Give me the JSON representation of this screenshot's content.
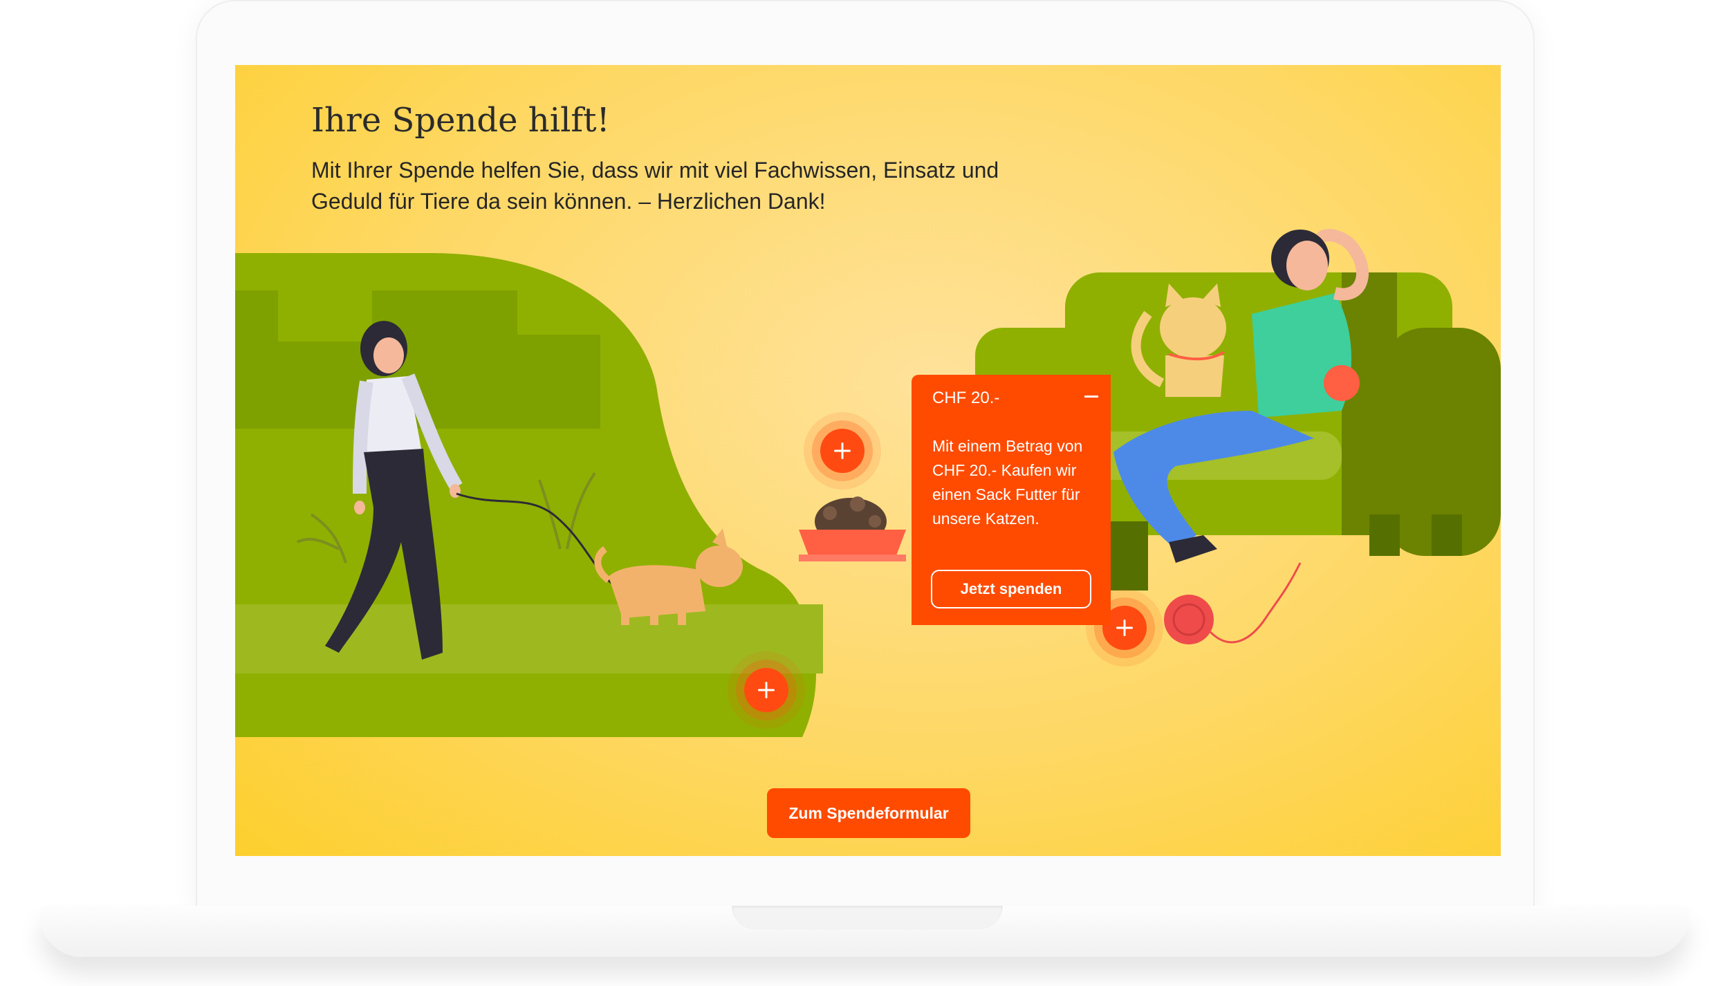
{
  "main": {
    "headline": "Ihre Spende hilft!",
    "intro": "Mit Ihrer Spende helfen Sie, dass wir mit viel Fachwissen, Einsatz und Geduld für Tiere da sein können. – Herzlichen Dank!",
    "cta_label": "Zum Spendeformular"
  },
  "popover": {
    "title": "CHF 20.-",
    "text": "Mit einem Betrag von CHF 20.- Kaufen wir einen Sack Futter für unsere Katzen.",
    "button_label": "Jetzt spenden",
    "close_icon": "minus-icon"
  },
  "hotspots": [
    {
      "name": "hotspot-food-bowl",
      "icon": "plus-icon"
    },
    {
      "name": "hotspot-walk",
      "icon": "plus-icon"
    },
    {
      "name": "hotspot-yarn",
      "icon": "plus-icon"
    }
  ],
  "colors": {
    "accent": "#ff4b00",
    "background": "#fed865",
    "grass": "#8fb000",
    "text": "#262626"
  }
}
